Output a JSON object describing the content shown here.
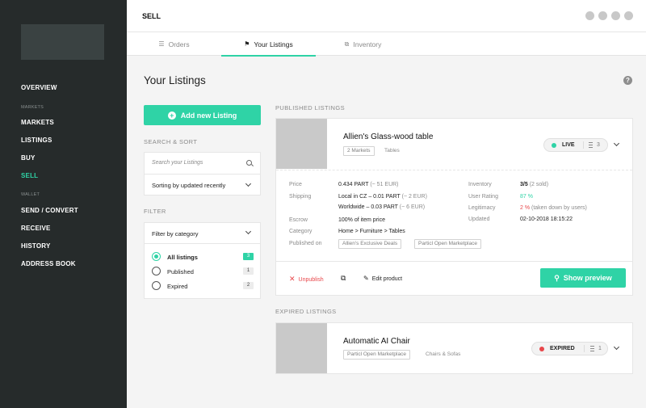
{
  "app": {
    "section_title": "SELL"
  },
  "sidebar": {
    "overview": "OVERVIEW",
    "markets_section": "MARKETS",
    "markets": "MARKETS",
    "listings": "LISTINGS",
    "buy": "BUY",
    "sell": "SELL",
    "wallet_section": "WALLET",
    "send_convert": "SEND / CONVERT",
    "receive": "RECEIVE",
    "history": "HISTORY",
    "address_book": "ADDRESS BOOK"
  },
  "tabs": [
    {
      "label": "Orders",
      "icon": "list-icon"
    },
    {
      "label": "Your Listings",
      "icon": "tag-icon"
    },
    {
      "label": "Inventory",
      "icon": "inventory-icon"
    }
  ],
  "main": {
    "title": "Your Listings",
    "help_glyph": "?",
    "add_button": "Add new Listing",
    "add_glyph": "+",
    "search_sort_label": "SEARCH & SORT",
    "search_placeholder": "Search your Listings",
    "sort_value": "Sorting by updated recently",
    "filter_label": "FILTER",
    "filter_category": "Filter by category",
    "filters": [
      {
        "label": "All listings",
        "count": "3"
      },
      {
        "label": "Published",
        "count": "1"
      },
      {
        "label": "Expired",
        "count": "2"
      }
    ]
  },
  "published": {
    "section_label": "PUBLISHED LISTINGS",
    "title": "Allien's Glass-wood table",
    "tag_markets": "2 Markets",
    "tag_category": "Tables",
    "status": "LIVE",
    "status_color": "#2fd3a6",
    "status_count": "3",
    "price_label": "Price",
    "price_value": "0.434 PART",
    "price_eur": "(~ 51 EUR)",
    "shipping_label": "Shipping",
    "shipping_local": "Local in CZ – 0.01 PART",
    "shipping_local_eur": "(~ 2 EUR)",
    "shipping_world": "Worldwide – 0.03 PART",
    "shipping_world_eur": "(~ 6 EUR)",
    "escrow_label": "Escrow",
    "escrow_value": "100% of item price",
    "category_label": "Category",
    "category_value": "Home > Furniture > Tables",
    "published_on_label": "Published on",
    "published_on": [
      "Allien's Exclusive Deals",
      "Particl Open Marketplace"
    ],
    "inventory_label": "Inventory",
    "inventory_value": "3/5",
    "inventory_sold": "(2 sold)",
    "rating_label": "User Rating",
    "rating_value": "87 %",
    "legitimacy_label": "Legitimacy",
    "legitimacy_value": "2 %",
    "legitimacy_note": "(taken down by users)",
    "updated_label": "Updated",
    "updated_value": "02-10-2018 18:15:22",
    "action_unpublish": "Unpublish",
    "action_edit": "Edit product",
    "preview_button": "Show preview"
  },
  "expired": {
    "section_label": "EXPIRED LISTINGS",
    "title": "Automatic AI Chair",
    "tag_market": "Particl Open Marketplace",
    "tag_category": "Chairs & Sofas",
    "status": "EXPIRED",
    "status_color": "#e8474b",
    "status_count": "1"
  }
}
